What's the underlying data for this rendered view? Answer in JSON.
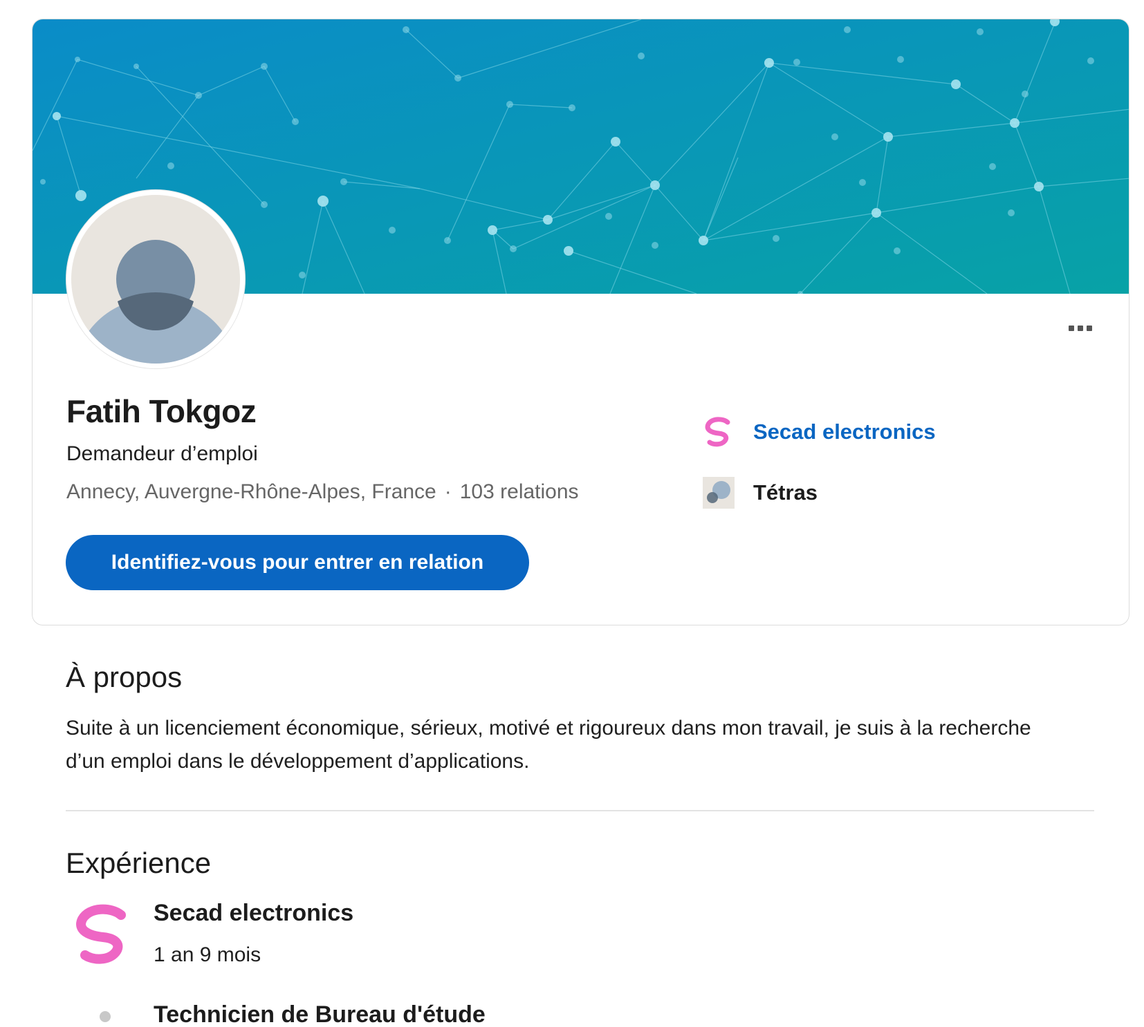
{
  "profile": {
    "name": "Fatih Tokgoz",
    "headline": "Demandeur d’emploi",
    "location": "Annecy, Auvergne-Rhône-Alpes, France",
    "separator": "·",
    "connections": "103 relations",
    "connect_label": "Identifiez-vous pour entrer en relation",
    "more_icon": "more-horizontal-icon"
  },
  "companies": [
    {
      "label": "Secad electronics",
      "icon": "secad-logo",
      "color": "#0a66c2"
    },
    {
      "label": "Tétras",
      "icon": "tetras-logo"
    }
  ],
  "about": {
    "title": "À propos",
    "text": "Suite à un licenciement économique, sérieux, motivé et rigoureux dans mon travail, je suis à la recherche d’un emploi dans le développement d’applications."
  },
  "experience": {
    "title": "Expérience",
    "company": "Secad electronics",
    "duration": "1 an 9 mois",
    "roles": [
      {
        "title": "Technicien de Bureau d'étude"
      }
    ]
  },
  "colors": {
    "accent": "#0a66c2",
    "banner_start": "#0a8fc6",
    "banner_end": "#07a0aa",
    "secad_pink": "#ee66c4"
  }
}
